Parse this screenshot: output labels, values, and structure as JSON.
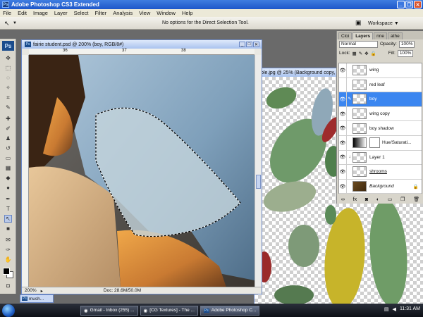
{
  "app": {
    "title": "Adobe Photoshop CS3 Extended",
    "logo": "Ps"
  },
  "menu": [
    "File",
    "Edit",
    "Image",
    "Layer",
    "Select",
    "Filter",
    "Analysis",
    "View",
    "Window",
    "Help"
  ],
  "options_bar": {
    "message": "No options for the Direct Selection Tool.",
    "workspace_label": "Workspace"
  },
  "doc_front": {
    "title": "fairie student.psd @ 200% (boy, RGB/8#)",
    "ruler_marks": [
      "36",
      "37",
      "38"
    ],
    "zoom": "200%",
    "doc_size": "Doc: 28.6M/50.0M"
  },
  "doc_back": {
    "title": "ltiple.jpg @ 25% (Background copy, RGB/8)"
  },
  "layers_panel": {
    "tabs": [
      "Cloi",
      "Layers",
      "nne",
      "athe"
    ],
    "active_tab": "Layers",
    "blend_mode": "Normal",
    "opacity_label": "Opacity:",
    "opacity_value": "100%",
    "lock_label": "Lock:",
    "fill_label": "Fill:",
    "fill_value": "100%",
    "layers": [
      {
        "name": "wing",
        "visible": true,
        "selected": false,
        "kind": "transparent"
      },
      {
        "name": "red leaf",
        "visible": false,
        "selected": false,
        "kind": "transparent"
      },
      {
        "name": "boy",
        "visible": true,
        "selected": true,
        "kind": "transparent"
      },
      {
        "name": "wing copy",
        "visible": true,
        "selected": false,
        "kind": "transparent"
      },
      {
        "name": "boy shadow",
        "visible": true,
        "selected": false,
        "kind": "transparent"
      },
      {
        "name": "Hue/Saturati...",
        "visible": true,
        "selected": false,
        "kind": "adjustment"
      },
      {
        "name": "Layer 1",
        "visible": true,
        "selected": false,
        "kind": "transparent"
      },
      {
        "name": "shrooms",
        "visible": true,
        "selected": false,
        "kind": "transparent"
      },
      {
        "name": "Background",
        "visible": true,
        "selected": false,
        "kind": "background"
      }
    ]
  },
  "minimized_doc": "mush...",
  "taskbar": {
    "items": [
      {
        "label": "Gmail - Inbox (255) ...",
        "active": false
      },
      {
        "label": "[CG Textures] - The ...",
        "active": false
      },
      {
        "label": "Adobe Photoshop C...",
        "active": true
      }
    ],
    "clock": "11:31 AM"
  },
  "colors": {
    "titlebar": "#1d56c9",
    "selected_layer": "#3b86f0"
  }
}
